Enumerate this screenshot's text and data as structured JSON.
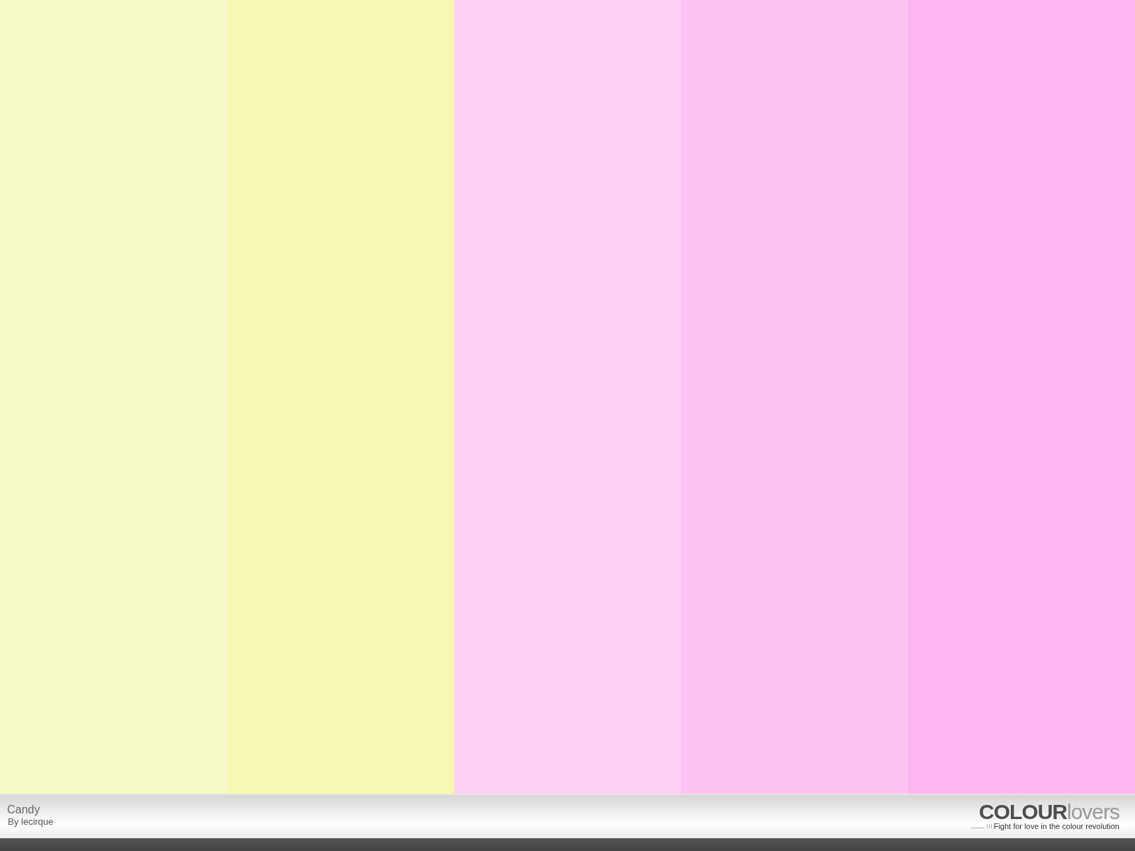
{
  "swatches": [
    {
      "color": "#f7f9c9"
    },
    {
      "color": "#f6f8b3"
    },
    {
      "color": "#ffd0f5"
    },
    {
      "color": "#fec4f1"
    },
    {
      "color": "#fdb6ef"
    }
  ],
  "palette": {
    "title": "Candy",
    "author": "By lecirque"
  },
  "logo": {
    "strong": "COLOUR",
    "light": "lovers",
    "tagline": "Fight for love in the colour revolution"
  }
}
